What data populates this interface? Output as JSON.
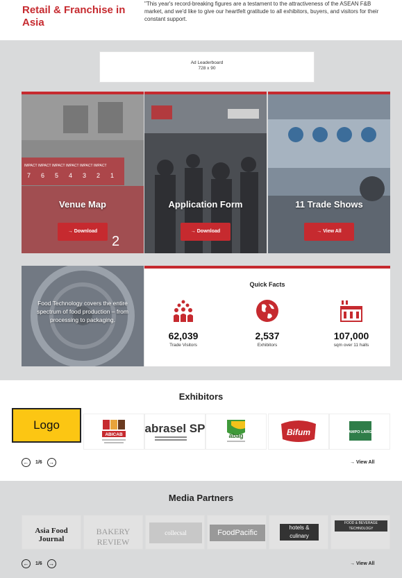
{
  "hero": {
    "title": "Retail & Franchise in Asia",
    "text_faded": "",
    "text": "\"This year's record-breaking figures are a testament to the attractiveness of the ASEAN F&B market, and we'd like to give our heartfelt gratitude to all exhibitors, buyers, and visitors for their constant support."
  },
  "ad": {
    "line1": "Ad Leaderboard",
    "line2": "728 x 90"
  },
  "cards": [
    {
      "title": "Venue Map",
      "button": "→ Download"
    },
    {
      "title": "Application Form",
      "button": "→ Download"
    },
    {
      "title": "11 Trade Shows",
      "button": "→ View All"
    }
  ],
  "food_tech": {
    "text": "Food Technology covers the entire spectrum of food production – from processing to packaging."
  },
  "quick_facts": {
    "title": "Quick Facts",
    "items": [
      {
        "icon": "people-group-icon",
        "value": "62,039",
        "label": "Trade Visitors"
      },
      {
        "icon": "globe-icon",
        "value": "2,537",
        "label": "Exhibitors"
      },
      {
        "icon": "exhibition-hall-icon",
        "value": "107,000",
        "label": "sqm over 11 halls"
      }
    ]
  },
  "exhibitors": {
    "title": "Exhibitors",
    "placeholder": "Logo",
    "logos": [
      "ABICAB",
      "abrasel SP",
      "abag",
      "Bifum",
      "CAMPO LARGO"
    ],
    "pager": "1/6",
    "view_all": "→ View All"
  },
  "media": {
    "title": "Media Partners",
    "logos": [
      "Asia Food Journal",
      "BAKERY REVIEW",
      "collecsal",
      "FoodPacific",
      "hotels & culinary",
      "FOOD & BEVERAGE TECHNOLOGY"
    ],
    "pager": "1/6",
    "view_all": "→ View All"
  },
  "colors": {
    "accent": "#c62a2f",
    "band": "#d9dadb",
    "placeholder": "#fcc613"
  }
}
